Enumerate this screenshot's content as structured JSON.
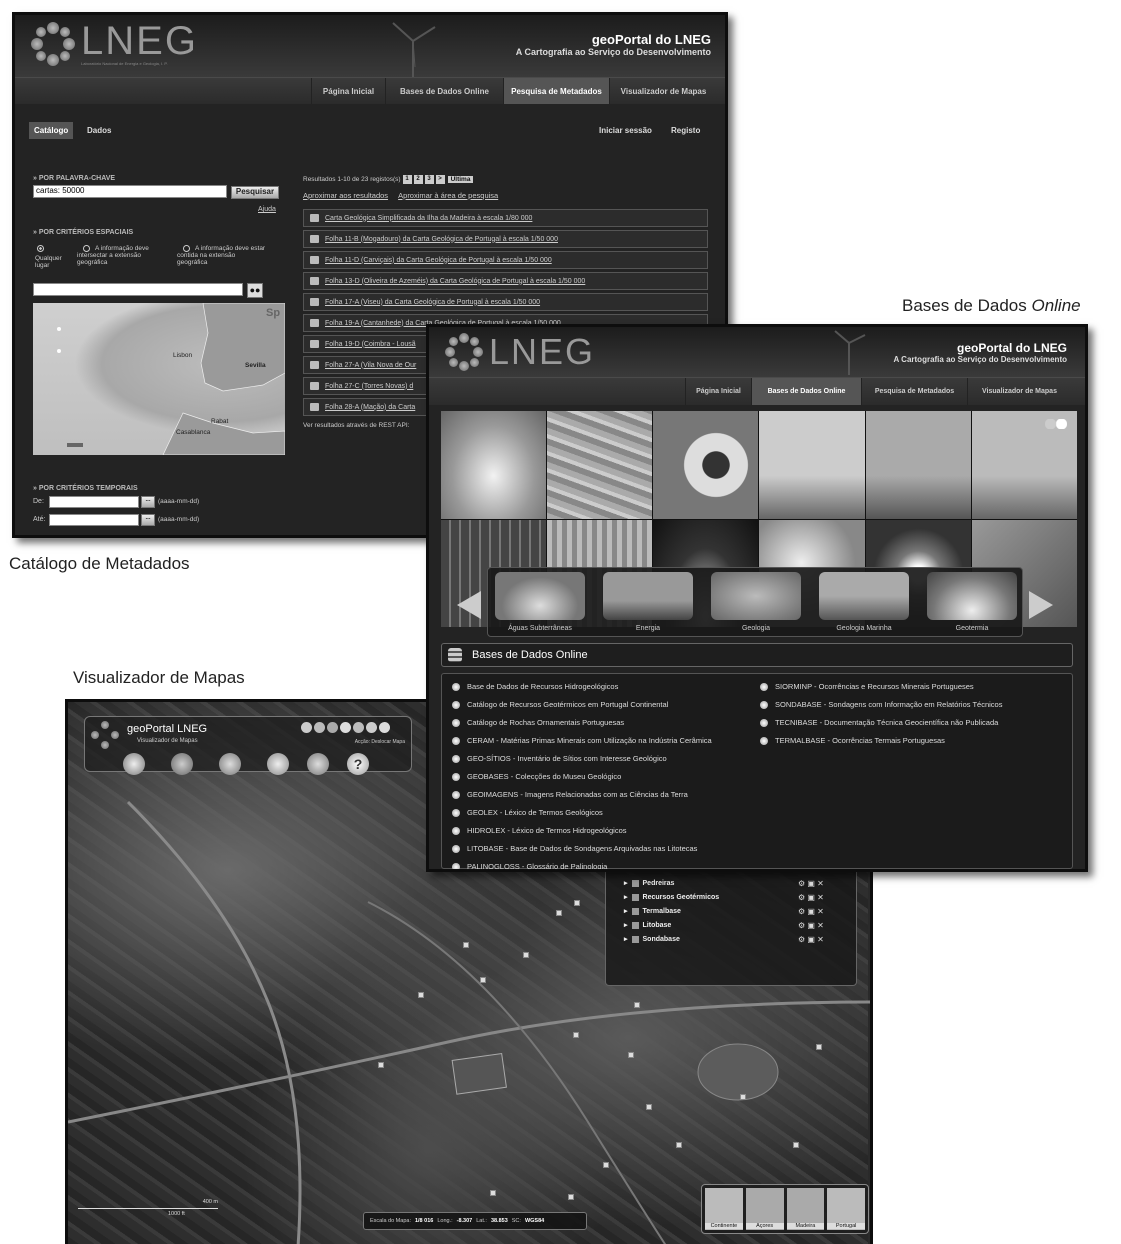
{
  "captions": {
    "catalogo": "Catálogo de Metadados",
    "bases_prefix": "Bases de Dados ",
    "bases_suffix": "Online",
    "visualizador": "Visualizador de Mapas"
  },
  "catalog": {
    "logo": "LNEG",
    "logo_sub": "Laboratório Nacional de Energia e Geologia, I. P.",
    "title": "geoPortal do LNEG",
    "subtitle": "A Cartografia ao Serviço do Desenvolvimento",
    "nav": [
      "Página Inicial",
      "Bases de Dados Online",
      "Pesquisa de Metadados",
      "Visualizador de Mapas"
    ],
    "nav_active": 2,
    "tabs": [
      "Catálogo",
      "Dados"
    ],
    "login": "Iniciar sessão",
    "register": "Registo",
    "keyword_header": "» POR PALAVRA-CHAVE",
    "keyword_value": "cartas: 50000",
    "search_button": "Pesquisar",
    "help_link": "Ajuda",
    "spatial_header": "» POR CRITÉRIOS ESPACIAIS",
    "radio1_l1": "Qualquer",
    "radio1_l2": "lugar",
    "radio2_l1": "A informação deve",
    "radio2_l2": "intersectar a extensão",
    "radio2_l3": "geográfica",
    "radio3_l1": "A informação deve estar",
    "radio3_l2": "contida na extensão",
    "radio3_l3": "geográfica",
    "map_labels": [
      "Lisbon",
      "Sevilla",
      "Sp",
      "Rabat",
      "Casablanca"
    ],
    "temporal_header": "» POR CRITÉRIOS TEMPORAIS",
    "from_label": "De:",
    "to_label": "Até:",
    "date_hint": "(aaaa-mm-dd)",
    "date_btn": "...",
    "results_summary": "Resultados 1-10 de 23 registos(s)",
    "pages": [
      "1",
      "2",
      "3",
      ">"
    ],
    "last_page": "Última",
    "zoom_results": "Aproximar aos resultados",
    "zoom_area": "Aproximar à área de pesquisa",
    "results": [
      "Carta Geológica Simplificada da Ilha da Madeira à escala 1/80 000",
      "Folha 11-B (Mogadouro) da Carta Geológica de Portugal à escala 1/50 000",
      "Folha 11-D (Carviçais) da Carta Geológica de Portugal à escala 1/50 000",
      "Folha 13-D (Oliveira de Azeméis) da Carta Geológica de Portugal à escala 1/50 000",
      "Folha 17-A (Viseu) da Carta Geológica de Portugal à escala 1/50 000",
      "Folha 19-A (Cantanhede) da Carta Geológica de Portugal à escala 1/50 000",
      "Folha 19-D (Coimbra - Lousã",
      "Folha 27-A (Vila Nova de Our",
      "Folha 27-C (Torres Novas) d",
      "Folha 28-A (Mação) da Carta"
    ],
    "rest_api": "Ver resultados através de REST API:"
  },
  "bases": {
    "logo": "LNEG",
    "title": "geoPortal do LNEG",
    "subtitle": "A Cartografia ao Serviço do Desenvolvimento",
    "nav": [
      "Página Inicial",
      "Bases de Dados Online",
      "Pesquisa de Metadados",
      "Visualizador de Mapas"
    ],
    "nav_active": 1,
    "categories": [
      "Águas Subterrâneas",
      "Energia",
      "Geologia",
      "Geologia Marinha",
      "Geotermia"
    ],
    "panel_title": "Bases de Dados Online",
    "databases_left": [
      "Base de Dados de Recursos Hidrogeológicos",
      "Catálogo de Recursos Geotérmicos em Portugal Continental",
      "Catálogo de Rochas Ornamentais Portuguesas",
      "CERAM - Matérias Primas Minerais com Utilização na Indústria Cerâmica",
      "GEO-SÍTIOS - Inventário de Sítios com Interesse Geológico",
      "GEOBASES - Colecções do Museu Geológico",
      "GEOIMAGENS - Imagens Relacionadas com as Ciências da Terra",
      "GEOLEX - Léxico de Termos Geológicos",
      "HIDROLEX - Léxico de Termos Hidrogeológicos",
      "LITOBASE - Base de Dados de Sondagens Arquivadas nas Litotecas",
      "PALINOGLOSS - Glossário de Palinologia"
    ],
    "databases_right": [
      "SIORMINP - Ocorrências e Recursos Minerais Portugueses",
      "SONDABASE - Sondagens com Informação em Relatórios Técnicos",
      "TECNIBASE - Documentação Técnica Geocientífica não Publicada",
      "TERMALBASE - Ocorrências Termais Portuguesas"
    ]
  },
  "viewer": {
    "title": "geoPortal LNEG",
    "subtitle": "Visualizador de Mapas",
    "action": "Acção: Deslocar Mapa",
    "layers": [
      "Pedreiras",
      "Recursos Geotérmicos",
      "Termalbase",
      "Litobase",
      "Sondabase"
    ],
    "scale_label": "Escala do Mapa:",
    "scale_value": "1/8 016",
    "long_label": "Long.:",
    "long_value": "-8.307",
    "lat_label": "Lat.:",
    "lat_value": "38.853",
    "sc_label": "SC:",
    "sc_value": "WGS84",
    "scalebar_top": "400 m",
    "scalebar_bottom": "1000 ft",
    "regions": [
      "Continente",
      "Açores",
      "Madeira",
      "Portugal"
    ]
  }
}
